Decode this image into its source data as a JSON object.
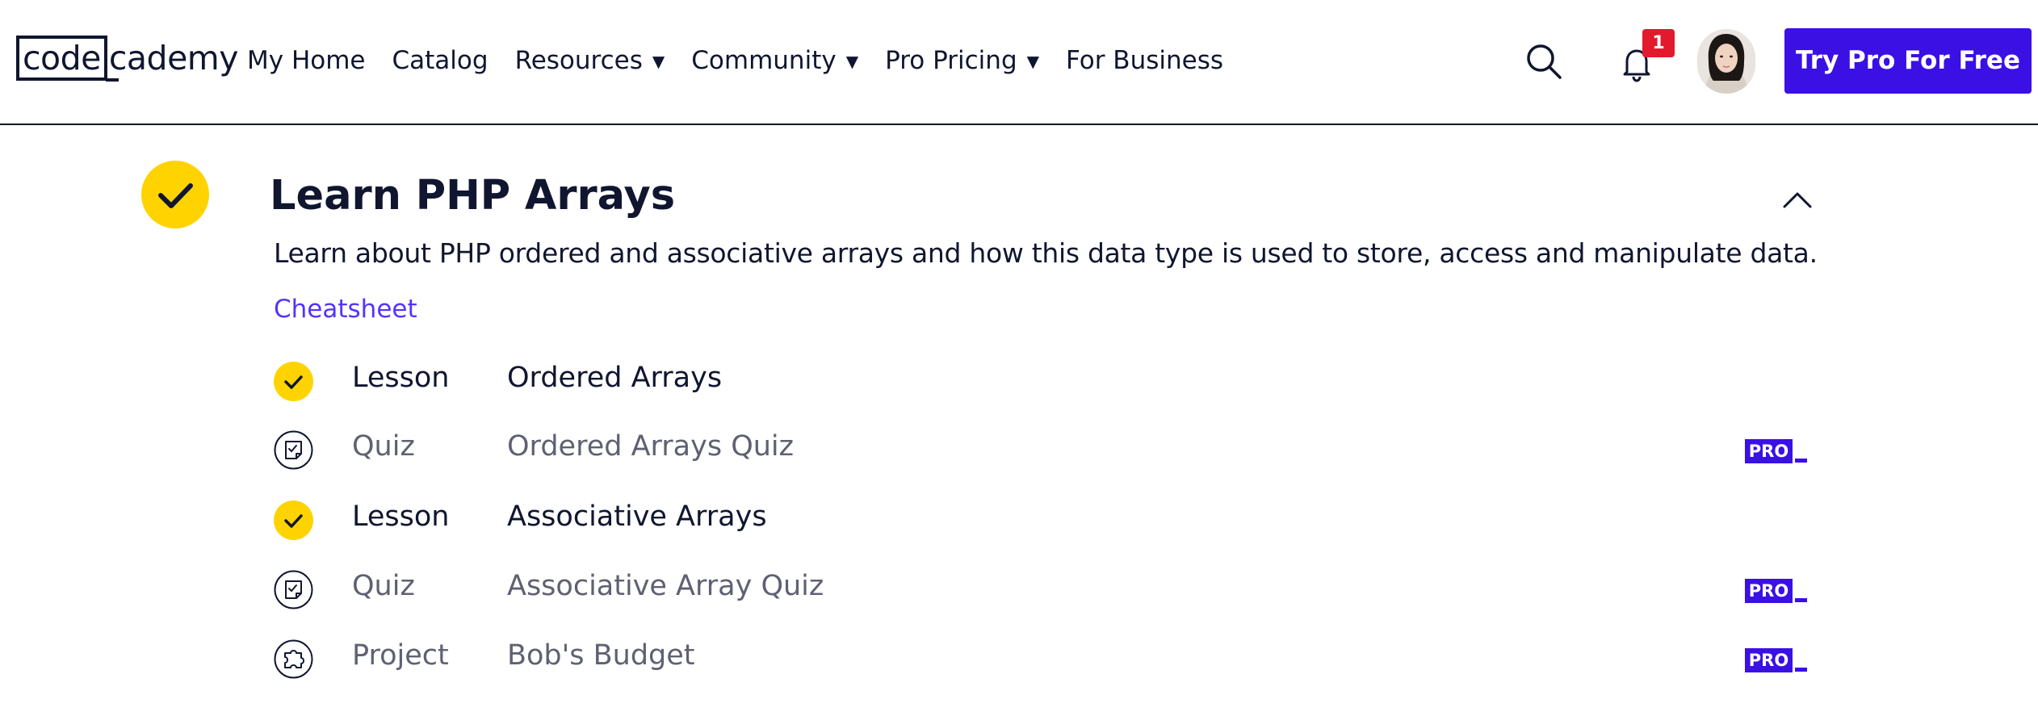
{
  "header": {
    "logo": {
      "left": "code",
      "right": "cademy"
    },
    "nav": [
      {
        "label": "My Home",
        "dropdown": false
      },
      {
        "label": "Catalog",
        "dropdown": false
      },
      {
        "label": "Resources",
        "dropdown": true
      },
      {
        "label": "Community",
        "dropdown": true
      },
      {
        "label": "Pro Pricing",
        "dropdown": true
      },
      {
        "label": "For Business",
        "dropdown": false
      }
    ],
    "caret": "▼",
    "notifications_count": "1",
    "cta_label": "Try Pro For Free"
  },
  "module": {
    "title": "Learn PHP Arrays",
    "description": "Learn about PHP ordered and associative arrays and how this data type is used to store, access and manipulate data.",
    "cheatsheet_label": "Cheatsheet",
    "completed": true,
    "expanded": true,
    "items": [
      {
        "type": "Lesson",
        "title": "Ordered Arrays",
        "status": "completed",
        "icon": "check-icon",
        "pro": false
      },
      {
        "type": "Quiz",
        "title": "Ordered Arrays Quiz",
        "status": "locked",
        "icon": "quiz-icon",
        "pro": true
      },
      {
        "type": "Lesson",
        "title": "Associative Arrays",
        "status": "completed",
        "icon": "check-icon",
        "pro": false
      },
      {
        "type": "Quiz",
        "title": "Associative Array Quiz",
        "status": "locked",
        "icon": "quiz-icon",
        "pro": true
      },
      {
        "type": "Project",
        "title": "Bob's Budget",
        "status": "locked",
        "icon": "puzzle-icon",
        "pro": true
      }
    ],
    "pro_badge_label": "PRO"
  },
  "colors": {
    "brand_navy": "#10162f",
    "accent_blue": "#3a10e5",
    "link_purple": "#5533ff",
    "complete_yellow": "#ffd300",
    "notification_red": "#e11a2d",
    "muted_text": "#5f6172"
  }
}
